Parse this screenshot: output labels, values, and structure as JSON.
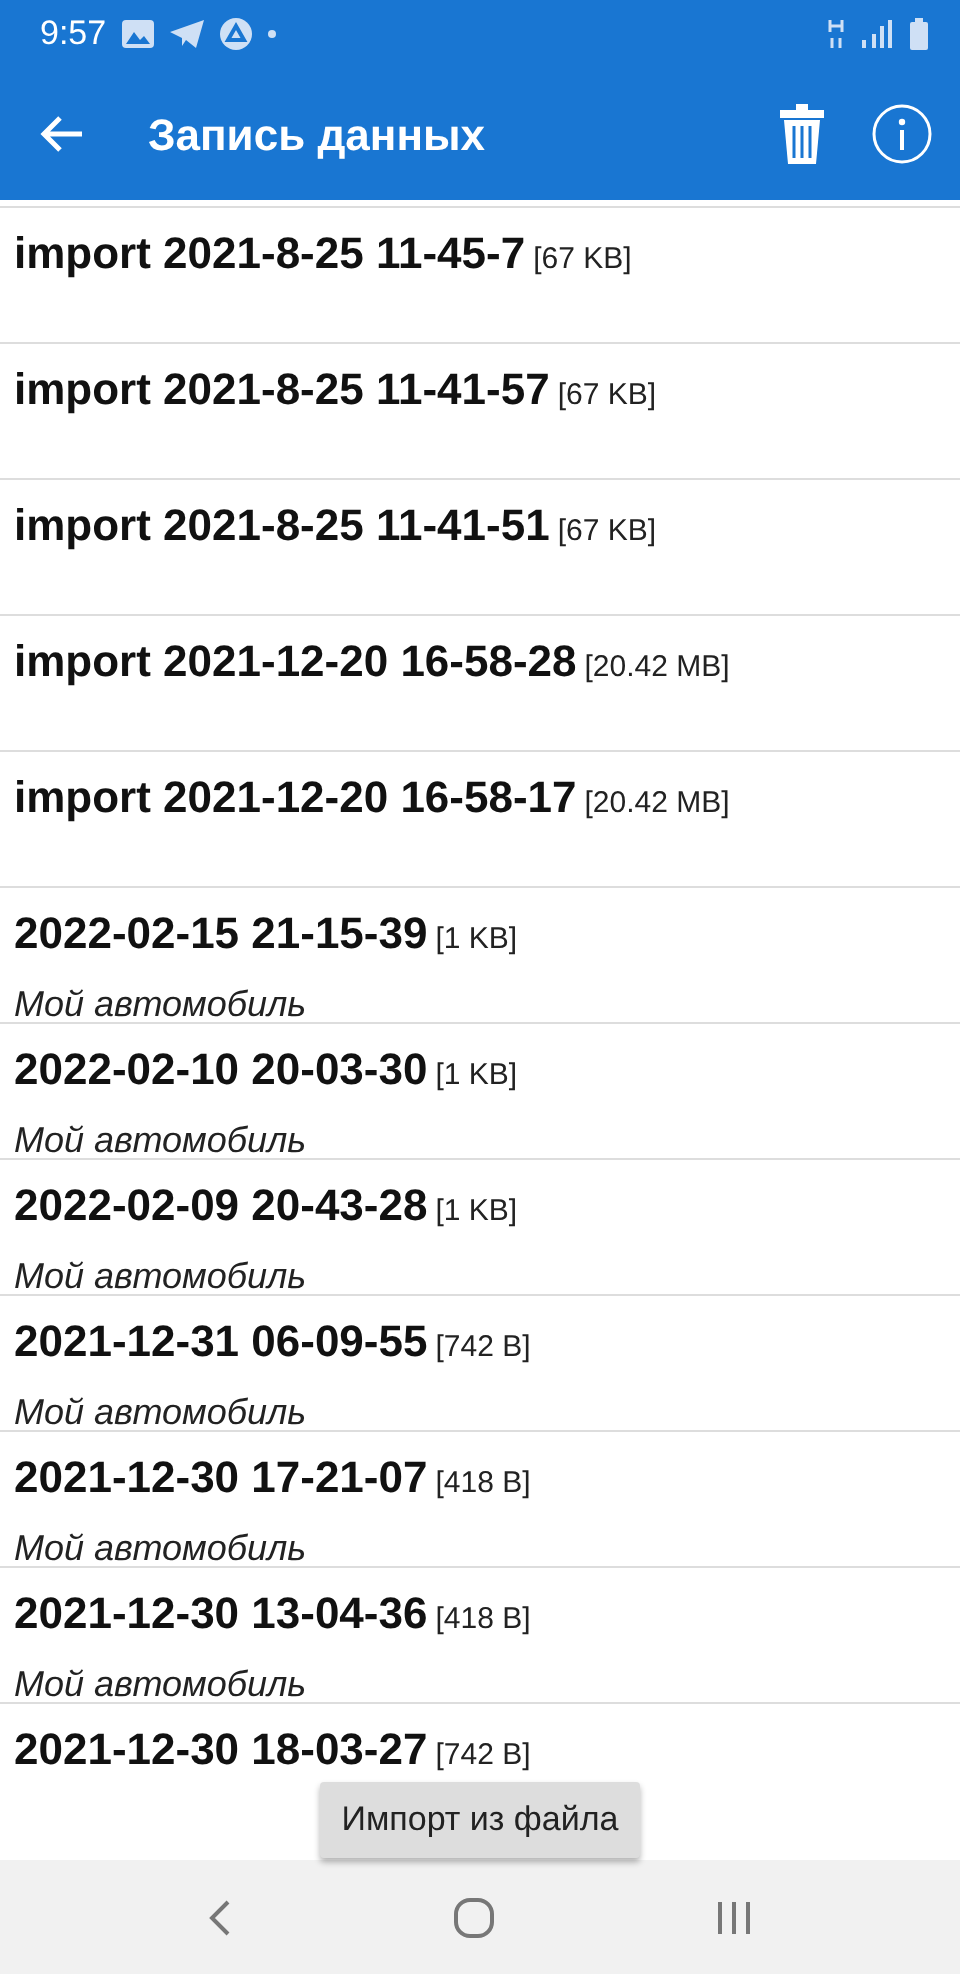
{
  "status_bar": {
    "time": "9:57"
  },
  "app_bar": {
    "title": "Запись данных"
  },
  "records": [
    {
      "name": "import 2021-8-25 11-45-7",
      "size": "[67 KB]"
    },
    {
      "name": "import 2021-8-25 11-41-57",
      "size": "[67 KB]"
    },
    {
      "name": "import 2021-8-25 11-41-51",
      "size": "[67 KB]"
    },
    {
      "name": "import 2021-12-20 16-58-28",
      "size": "[20.42 MB]"
    },
    {
      "name": "import 2021-12-20 16-58-17",
      "size": "[20.42 MB]"
    },
    {
      "name": "2022-02-15 21-15-39",
      "size": "[1 KB]",
      "subtitle": "Мой автомобиль"
    },
    {
      "name": "2022-02-10 20-03-30",
      "size": "[1 KB]",
      "subtitle": "Мой автомобиль"
    },
    {
      "name": "2022-02-09 20-43-28",
      "size": "[1 KB]",
      "subtitle": "Мой автомобиль"
    },
    {
      "name": "2021-12-31 06-09-55",
      "size": "[742 B]",
      "subtitle": "Мой автомобиль"
    },
    {
      "name": "2021-12-30 17-21-07",
      "size": "[418 B]",
      "subtitle": "Мой автомобиль"
    },
    {
      "name": "2021-12-30 13-04-36",
      "size": "[418 B]",
      "subtitle": "Мой автомобиль"
    },
    {
      "name": "2021-12-30 18-03-27",
      "size": "[742 B]"
    }
  ],
  "import_button": {
    "label": "Импорт из файла"
  }
}
